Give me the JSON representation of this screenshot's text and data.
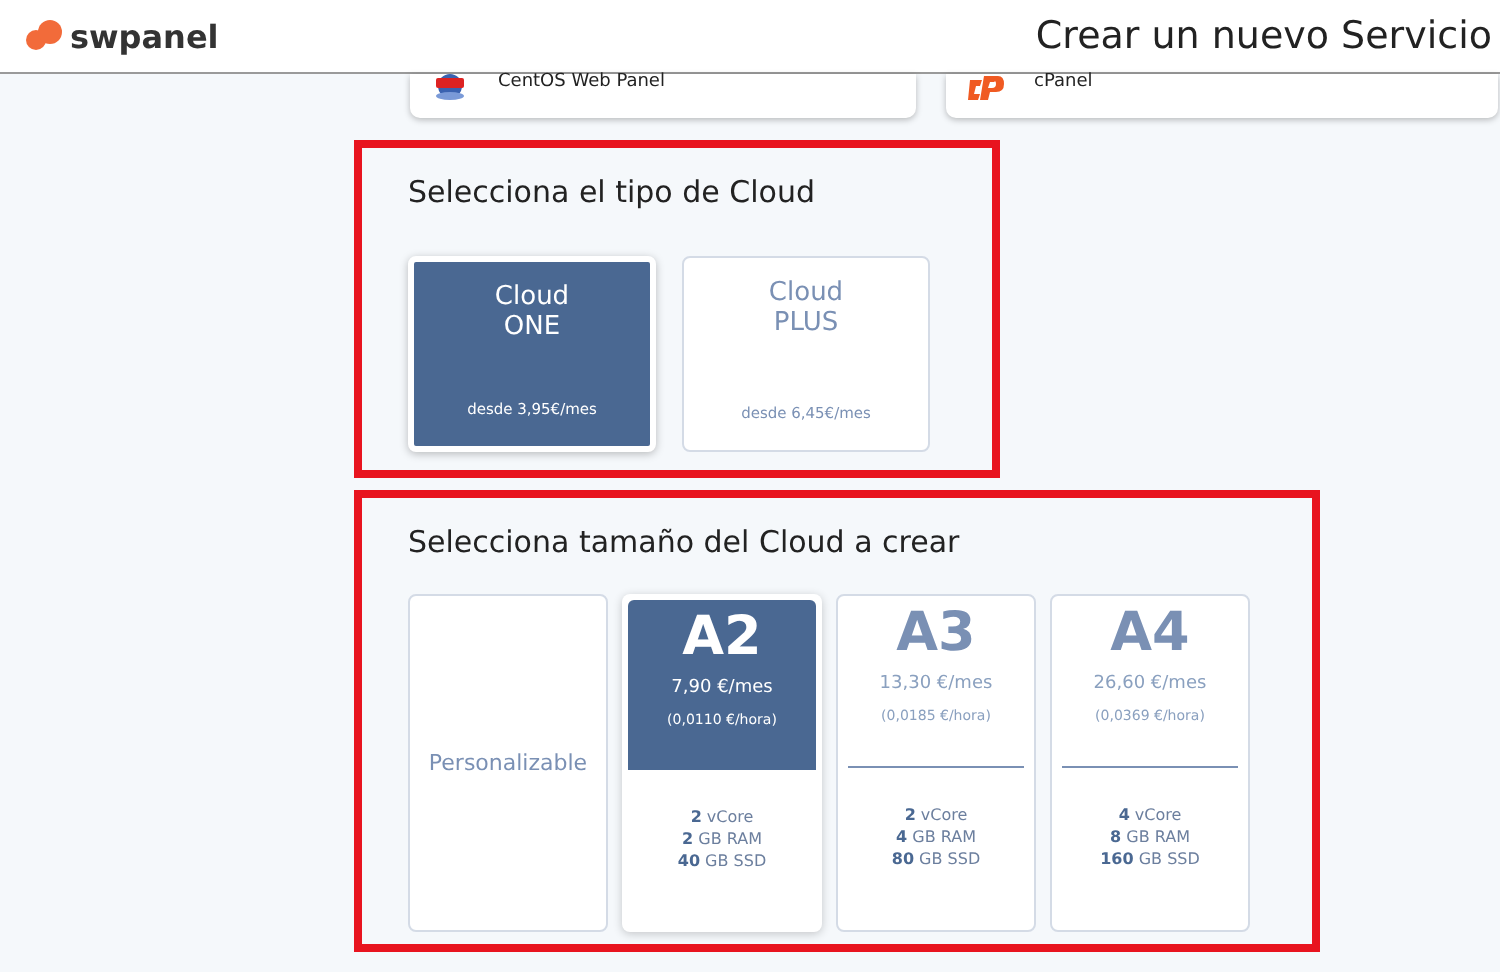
{
  "header": {
    "logo": "swpanel",
    "title": "Crear un nuevo Servicio"
  },
  "panels": [
    {
      "name": "CentOS Web Panel",
      "kind": "cwp"
    },
    {
      "name": "cPanel",
      "kind": "cpanel"
    }
  ],
  "cloud_type": {
    "title": "Selecciona el tipo de Cloud",
    "highlighted": true,
    "options": [
      {
        "name": "Cloud\nONE",
        "price": "desde 3,95€/mes",
        "selected": true
      },
      {
        "name": "Cloud\nPLUS",
        "price": "desde 6,45€/mes",
        "selected": false
      }
    ]
  },
  "cloud_size": {
    "title": "Selecciona tamaño del Cloud a crear",
    "highlighted": true,
    "custom": {
      "label": "Personalizable",
      "selected": false
    },
    "plans": [
      {
        "name": "A2",
        "monthly": "7,90 €/mes",
        "hourly": "(0,0110 €/hora)",
        "specs": [
          "**2** vCore",
          "**2** GB RAM",
          "**40** GB SSD"
        ],
        "selected": true
      },
      {
        "name": "A3",
        "monthly": "13,30 €/mes",
        "hourly": "(0,0185 €/hora)",
        "specs": [
          "**2** vCore",
          "**4** GB RAM",
          "**80** GB SSD"
        ],
        "selected": false
      },
      {
        "name": "A4",
        "monthly": "26,60 €/mes",
        "hourly": "(0,0369 €/hora)",
        "specs": [
          "**4** vCore",
          "**8** GB RAM",
          "**160** GB SSD"
        ],
        "selected": false
      }
    ]
  }
}
